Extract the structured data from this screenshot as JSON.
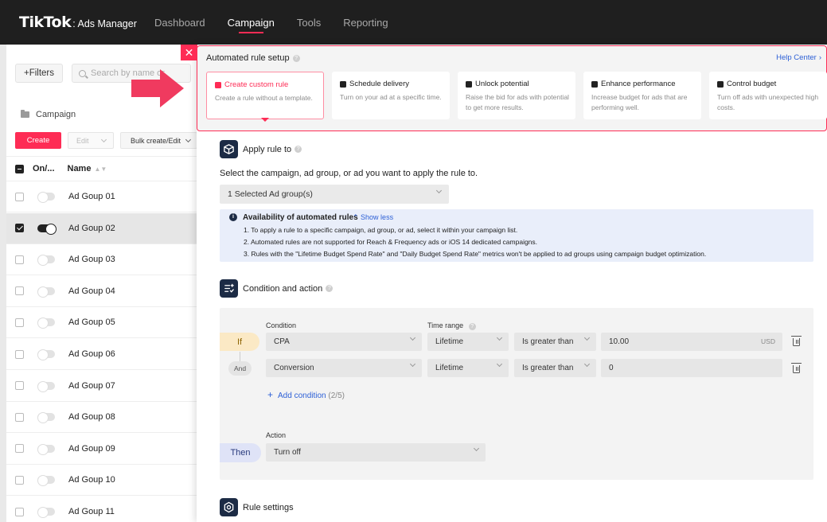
{
  "topbar": {
    "logo_main": "TikTok",
    "logo_sub": ": Ads Manager",
    "nav": [
      {
        "label": "Dashboard",
        "active": false
      },
      {
        "label": "Campaign",
        "active": true
      },
      {
        "label": "Tools",
        "active": false
      },
      {
        "label": "Reporting",
        "active": false
      }
    ]
  },
  "left": {
    "filters_label": "+Filters",
    "search_placeholder": "Search by name or",
    "crumb": "Campaign",
    "create_label": "Create",
    "edit_label": "Edit",
    "bulk_label": "Bulk create/Edit",
    "col_onoff": "On/...",
    "col_name": "Name",
    "rows": [
      {
        "name": "Ad Goup 01",
        "checked": false,
        "on": false
      },
      {
        "name": "Ad Goup 02",
        "checked": true,
        "on": true
      },
      {
        "name": "Ad Goup 03",
        "checked": false,
        "on": false
      },
      {
        "name": "Ad Goup 04",
        "checked": false,
        "on": false
      },
      {
        "name": "Ad Goup 05",
        "checked": false,
        "on": false
      },
      {
        "name": "Ad Goup 06",
        "checked": false,
        "on": false
      },
      {
        "name": "Ad Goup 07",
        "checked": false,
        "on": false
      },
      {
        "name": "Ad Goup 08",
        "checked": false,
        "on": false
      },
      {
        "name": "Ad Goup 09",
        "checked": false,
        "on": false
      },
      {
        "name": "Ad Goup 10",
        "checked": false,
        "on": false
      },
      {
        "name": "Ad Goup 11",
        "checked": false,
        "on": false
      }
    ]
  },
  "drawer": {
    "close_icon": "close-icon",
    "setup_title": "Automated rule setup",
    "help_center": "Help Center",
    "cards": [
      {
        "title": "Create custom rule",
        "desc": "Create a rule without a template.",
        "active": true
      },
      {
        "title": "Schedule delivery",
        "desc": "Turn on your ad at a specific time.",
        "active": false
      },
      {
        "title": "Unlock potential",
        "desc": "Raise the bid for ads with potential to get more results.",
        "active": false
      },
      {
        "title": "Enhance performance",
        "desc": "Increase budget for ads that are performing well.",
        "active": false
      },
      {
        "title": "Control budget",
        "desc": "Turn off ads with unexpected high costs.",
        "active": false
      }
    ],
    "apply": {
      "title": "Apply rule to",
      "subtitle": "Select the campaign, ad group, or ad you want to apply the rule to.",
      "selected": "1 Selected Ad group(s)",
      "info_title": "Availability of automated rules",
      "show_less": "Show less",
      "info_lines": [
        "1. To apply a rule to a specific campaign, ad group, or ad, select it within your campaign list.",
        "2. Automated rules are not supported for Reach & Frequency ads or iOS 14 dedicated campaigns.",
        "3. Rules with the \"Lifetime Budget Spend Rate\" and \"Daily Budget Spend Rate\" metrics won't be applied to ad groups using campaign budget optimization."
      ]
    },
    "condition": {
      "title": "Condition and action",
      "label_condition": "Condition",
      "label_time": "Time range",
      "if_label": "If",
      "and_label": "And",
      "then_label": "Then",
      "rows": [
        {
          "metric": "CPA",
          "time": "Lifetime",
          "op": "Is greater than",
          "value": "10.00",
          "unit": "USD"
        },
        {
          "metric": "Conversion",
          "time": "Lifetime",
          "op": "Is greater than",
          "value": "0",
          "unit": ""
        }
      ],
      "add_condition": "Add condition",
      "add_count": "(2/5)",
      "label_action": "Action",
      "action": "Turn off"
    },
    "settings": {
      "title": "Rule settings"
    }
  },
  "colors": {
    "accent": "#fe2c55",
    "link": "#2c5fd6",
    "topbar": "#1f1f1f",
    "icon_bg": "#1c2b45"
  }
}
